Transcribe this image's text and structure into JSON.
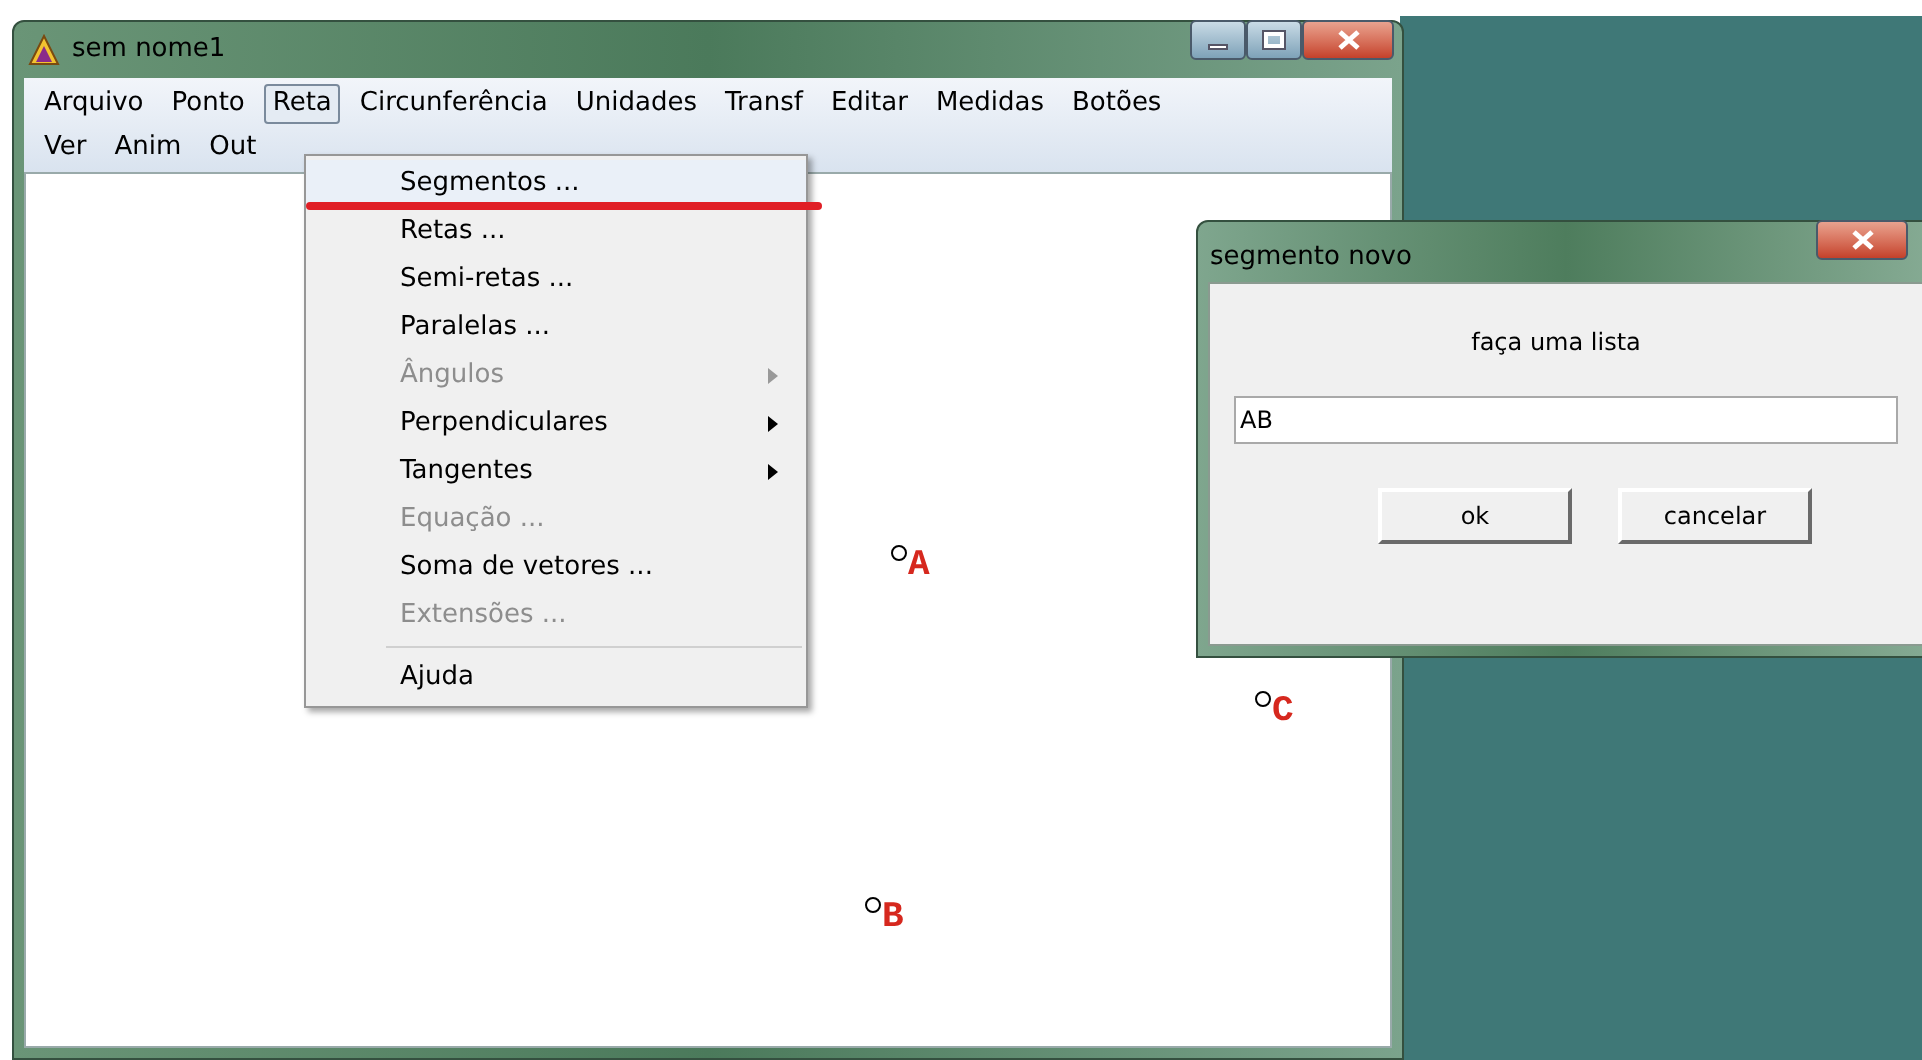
{
  "window": {
    "title": "sem nome1"
  },
  "menu_bar": [
    {
      "label": "Arquivo",
      "selected": false
    },
    {
      "label": "Ponto",
      "selected": false
    },
    {
      "label": "Reta",
      "selected": true
    },
    {
      "label": "Circunferência",
      "selected": false
    },
    {
      "label": "Unidades",
      "selected": false
    },
    {
      "label": "Transf",
      "selected": false
    },
    {
      "label": "Editar",
      "selected": false
    },
    {
      "label": "Medidas",
      "selected": false
    },
    {
      "label": "Botões",
      "selected": false
    },
    {
      "label": "Ver",
      "selected": false
    },
    {
      "label": "Anim",
      "selected": false
    },
    {
      "label": "Out",
      "selected": false
    }
  ],
  "dropdown": [
    {
      "kind": "item",
      "label": "Segmentos ...",
      "disabled": false,
      "submenu": false
    },
    {
      "kind": "item",
      "label": "Retas ...",
      "disabled": false,
      "submenu": false
    },
    {
      "kind": "item",
      "label": "Semi-retas ...",
      "disabled": false,
      "submenu": false
    },
    {
      "kind": "item",
      "label": "Paralelas ...",
      "disabled": false,
      "submenu": false
    },
    {
      "kind": "item",
      "label": "Ângulos",
      "disabled": true,
      "submenu": true
    },
    {
      "kind": "item",
      "label": "Perpendiculares",
      "disabled": false,
      "submenu": true
    },
    {
      "kind": "item",
      "label": "Tangentes",
      "disabled": false,
      "submenu": true
    },
    {
      "kind": "item",
      "label": "Equação ...",
      "disabled": true,
      "submenu": false
    },
    {
      "kind": "item",
      "label": "Soma de vetores ...",
      "disabled": false,
      "submenu": false
    },
    {
      "kind": "item",
      "label": "Extensões ...",
      "disabled": true,
      "submenu": false
    },
    {
      "kind": "separator"
    },
    {
      "kind": "item",
      "label": "Ajuda",
      "disabled": false,
      "submenu": false
    }
  ],
  "points": [
    {
      "label": "A"
    },
    {
      "label": "C"
    },
    {
      "label": "B"
    }
  ],
  "dialog": {
    "title": "segmento novo",
    "prompt": "faça uma lista",
    "input_value": "AB",
    "buttons": [
      "ok",
      "cancelar"
    ]
  }
}
